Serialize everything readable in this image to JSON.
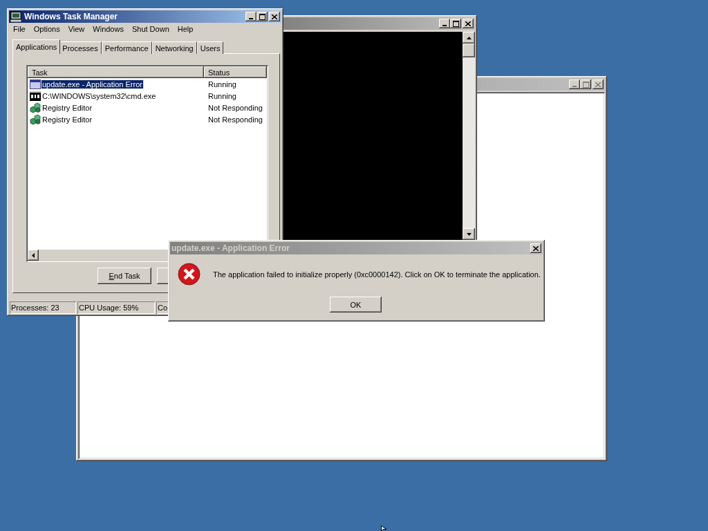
{
  "task_manager": {
    "title": "Windows Task Manager",
    "menu": [
      "File",
      "Options",
      "View",
      "Windows",
      "Shut Down",
      "Help"
    ],
    "tabs": [
      {
        "label": "Applications",
        "selected": true
      },
      {
        "label": "Processes",
        "selected": false
      },
      {
        "label": "Performance",
        "selected": false
      },
      {
        "label": "Networking",
        "selected": false
      },
      {
        "label": "Users",
        "selected": false
      }
    ],
    "columns": [
      "Task",
      "Status"
    ],
    "rows": [
      {
        "task": "update.exe - Application Error",
        "status": "Running",
        "kind": "window",
        "selected": true
      },
      {
        "task": "C:\\WINDOWS\\system32\\cmd.exe",
        "status": "Running",
        "kind": "console",
        "selected": false
      },
      {
        "task": "Registry Editor",
        "status": "Not Responding",
        "kind": "registry",
        "selected": false
      },
      {
        "task": "Registry Editor",
        "status": "Not Responding",
        "kind": "registry",
        "selected": false
      }
    ],
    "end_task_button": "End Task",
    "status_bar": [
      "Processes: 23",
      "CPU Usage: 59%",
      "Co"
    ]
  },
  "error_dialog": {
    "title": "update.exe - Application Error",
    "message": "The application failed to initialize properly (0xc0000142). Click on OK to terminate the application.",
    "button": "OK"
  }
}
